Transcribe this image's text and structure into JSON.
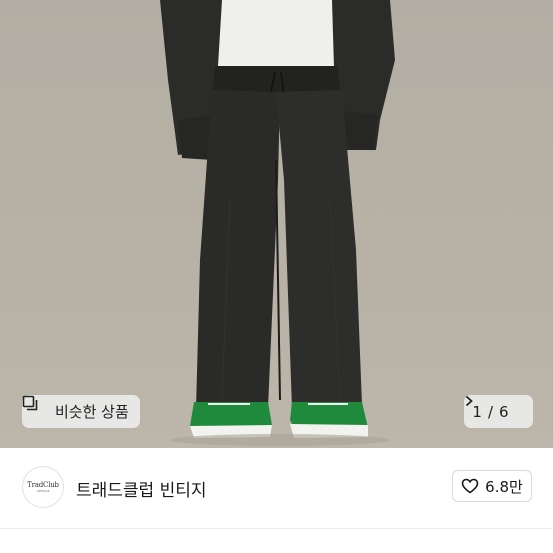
{
  "similar_button": {
    "label": "비슷한 상품",
    "icon": "similar-items-icon"
  },
  "pager": {
    "current": "1",
    "separator": "/",
    "total": "6",
    "icon": "chevron-right-icon"
  },
  "shop": {
    "name": "트래드클럽 빈티지",
    "logo_text": "TradClub",
    "logo_subtext": "VINTAGE"
  },
  "like": {
    "count": "6.8만",
    "icon": "heart-outline-icon"
  },
  "product_title_partial": "...",
  "colors": {
    "hero_background": "#b6b0a4",
    "pants": "#2a2a28",
    "sneaker_green": "#1f8a3c",
    "button_background": "#ebebeb"
  }
}
